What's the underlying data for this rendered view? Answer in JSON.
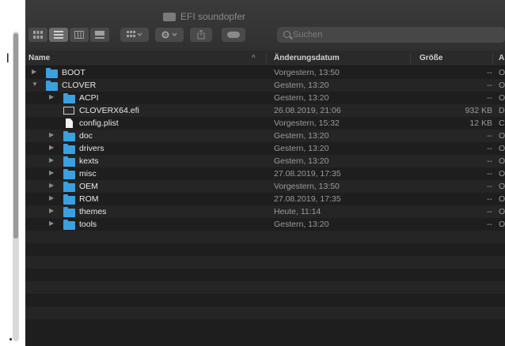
{
  "window": {
    "title": "EFI soundopfer"
  },
  "left_char": "l",
  "toolbar": {
    "search_placeholder": "Suchen"
  },
  "columns": {
    "name": "Name",
    "date": "Änderungsdatum",
    "size": "Größe",
    "kind": "A"
  },
  "rows": [
    {
      "name": "BOOT",
      "date": "Vorgestern, 13:50",
      "size": "--",
      "kind": "O",
      "type": "folder",
      "level": 0,
      "disclosure": "collapsed"
    },
    {
      "name": "CLOVER",
      "date": "Gestern, 13:20",
      "size": "--",
      "kind": "O",
      "type": "folder",
      "level": 0,
      "disclosure": "expanded"
    },
    {
      "name": "ACPI",
      "date": "Gestern, 13:20",
      "size": "--",
      "kind": "O",
      "type": "folder",
      "level": 1,
      "disclosure": "collapsed"
    },
    {
      "name": "CLOVERX64.efi",
      "date": "26.08.2019, 21:06",
      "size": "932 KB",
      "kind": "D",
      "type": "efi",
      "level": 1,
      "disclosure": "none"
    },
    {
      "name": "config.plist",
      "date": "Vorgestern, 15:32",
      "size": "12 KB",
      "kind": "C",
      "type": "doc",
      "level": 1,
      "disclosure": "none"
    },
    {
      "name": "doc",
      "date": "Gestern, 13:20",
      "size": "--",
      "kind": "O",
      "type": "folder",
      "level": 1,
      "disclosure": "collapsed"
    },
    {
      "name": "drivers",
      "date": "Gestern, 13:20",
      "size": "--",
      "kind": "O",
      "type": "folder",
      "level": 1,
      "disclosure": "collapsed"
    },
    {
      "name": "kexts",
      "date": "Gestern, 13:20",
      "size": "--",
      "kind": "O",
      "type": "folder",
      "level": 1,
      "disclosure": "collapsed"
    },
    {
      "name": "misc",
      "date": "27.08.2019, 17:35",
      "size": "--",
      "kind": "O",
      "type": "folder",
      "level": 1,
      "disclosure": "collapsed"
    },
    {
      "name": "OEM",
      "date": "Vorgestern, 13:50",
      "size": "--",
      "kind": "O",
      "type": "folder",
      "level": 1,
      "disclosure": "collapsed"
    },
    {
      "name": "ROM",
      "date": "27.08.2019, 17:35",
      "size": "--",
      "kind": "O",
      "type": "folder",
      "level": 1,
      "disclosure": "collapsed"
    },
    {
      "name": "themes",
      "date": "Heute, 11:14",
      "size": "--",
      "kind": "O",
      "type": "folder",
      "level": 1,
      "disclosure": "collapsed"
    },
    {
      "name": "tools",
      "date": "Gestern, 13:20",
      "size": "--",
      "kind": "O",
      "type": "folder",
      "level": 1,
      "disclosure": "collapsed"
    }
  ],
  "colors": {
    "folder": "#3ba0e0",
    "background": "#1e1e1e",
    "row_alt": "#252525"
  }
}
